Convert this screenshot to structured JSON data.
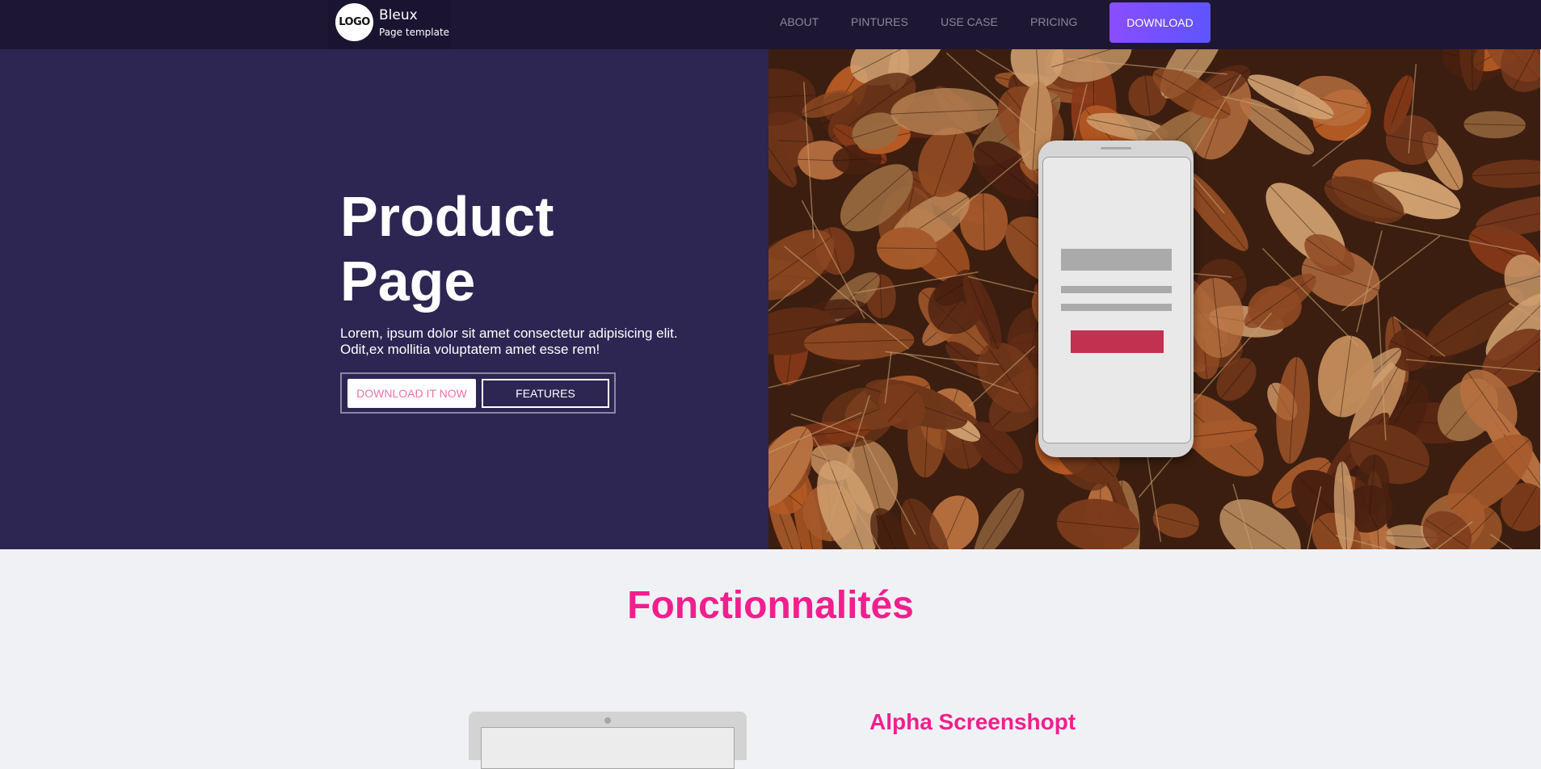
{
  "navbar": {
    "logo_text": "LOGO",
    "brand_name": "Bleux",
    "brand_subtitle": "Page template",
    "links": [
      {
        "label": "ABOUT"
      },
      {
        "label": "PINTURES"
      },
      {
        "label": "USE CASE"
      },
      {
        "label": "PRICING"
      }
    ],
    "download_label": "DOWNLOAD"
  },
  "hero": {
    "title": "Product Page",
    "description": "Lorem, ipsum dolor sit amet consectetur adipisicing elit. Odit,ex mollitia voluptatem amet esse rem!",
    "primary_button": "DOWNLOAD IT NOW",
    "secondary_button": "FEATURES"
  },
  "features": {
    "title": "Fonctionnalités",
    "first_item_title": "Alpha Screenshopt"
  },
  "colors": {
    "nav_bg": "#1e1733",
    "hero_bg": "#2d2552",
    "accent_pink": "#f11f8d",
    "download_gradient_start": "#8a4dff",
    "download_gradient_end": "#5d55ff",
    "phone_button": "#c2314f"
  },
  "icons": {
    "logo": "logo-circle",
    "hero_image": "autumn-leaves-photo",
    "mockups": [
      "phone-mockup",
      "laptop-mockup"
    ]
  }
}
